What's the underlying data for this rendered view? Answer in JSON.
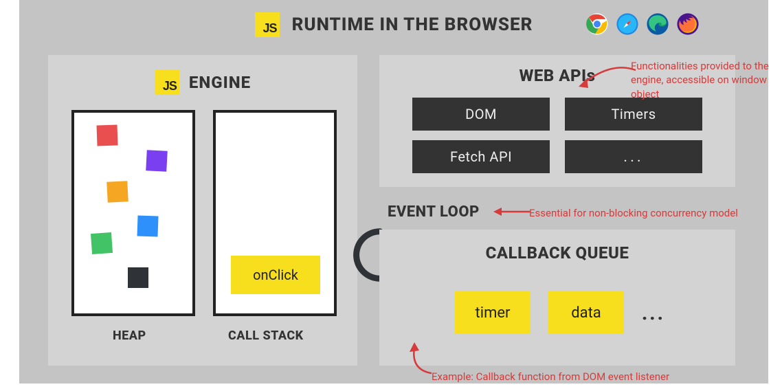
{
  "title": "RUNTIME IN THE BROWSER",
  "js_badge": "JS",
  "browsers": [
    "chrome",
    "safari",
    "edge",
    "firefox"
  ],
  "engine": {
    "title": "ENGINE",
    "heap_label": "HEAP",
    "stack_label": "CALL STACK",
    "stack_item": "onClick"
  },
  "webapi": {
    "title": "WEB APIs",
    "items": [
      "DOM",
      "Timers",
      "Fetch API",
      "..."
    ]
  },
  "eventloop_label": "EVENT LOOP",
  "callback_queue": {
    "title": "CALLBACK QUEUE",
    "items": [
      "timer",
      "data"
    ],
    "more": "..."
  },
  "annotations": {
    "webapi_note": "Functionalities provided to the engine, accessible on window object",
    "eventloop_note": "Essential for non-blocking concurrency model",
    "cbq_note": "Example: Callback function from DOM event listener"
  },
  "colors": {
    "js_yellow": "#f7df1e",
    "panel": "#d3d3d3",
    "canvas": "#c4c4c4",
    "dark": "#333333",
    "annotation": "#d63a3a"
  }
}
